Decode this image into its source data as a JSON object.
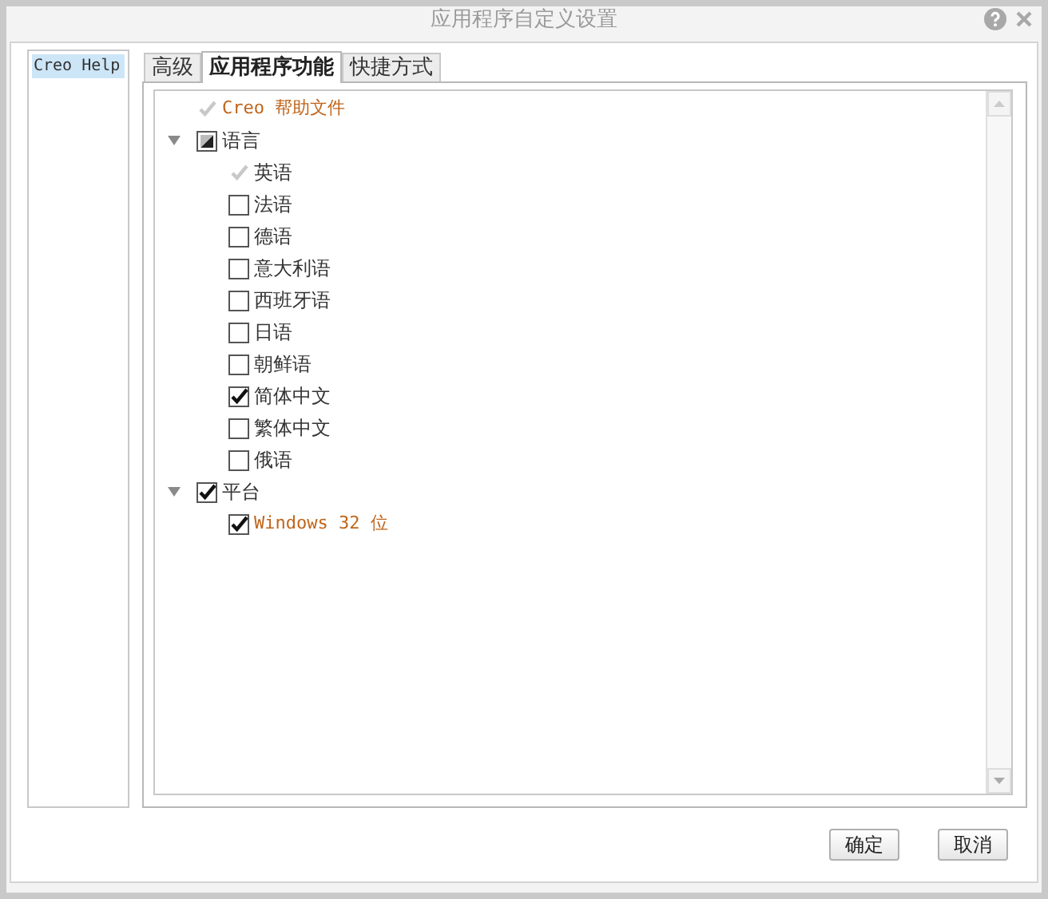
{
  "window": {
    "title": "应用程序自定义设置"
  },
  "sidebar": {
    "items": [
      {
        "label": "Creo Help",
        "selected": true
      }
    ]
  },
  "tabs": [
    {
      "label": "高级",
      "selected": false
    },
    {
      "label": "应用程序功能",
      "selected": true
    },
    {
      "label": "快捷方式",
      "selected": false
    }
  ],
  "tree": [
    {
      "label": "Creo 帮助文件",
      "checked": true,
      "indeterminate": false,
      "disabled": true,
      "kind": "code"
    },
    {
      "label": "语言",
      "checked": false,
      "indeterminate": true,
      "disabled": false,
      "expanded": true,
      "children": [
        {
          "label": "英语",
          "checked": true,
          "indeterminate": false,
          "disabled": true
        },
        {
          "label": "法语",
          "checked": false,
          "indeterminate": false,
          "disabled": false
        },
        {
          "label": "德语",
          "checked": false,
          "indeterminate": false,
          "disabled": false
        },
        {
          "label": "意大利语",
          "checked": false,
          "indeterminate": false,
          "disabled": false
        },
        {
          "label": "西班牙语",
          "checked": false,
          "indeterminate": false,
          "disabled": false
        },
        {
          "label": "日语",
          "checked": false,
          "indeterminate": false,
          "disabled": false
        },
        {
          "label": "朝鲜语",
          "checked": false,
          "indeterminate": false,
          "disabled": false
        },
        {
          "label": "简体中文",
          "checked": true,
          "indeterminate": false,
          "disabled": false
        },
        {
          "label": "繁体中文",
          "checked": false,
          "indeterminate": false,
          "disabled": false
        },
        {
          "label": "俄语",
          "checked": false,
          "indeterminate": false,
          "disabled": false
        }
      ]
    },
    {
      "label": "平台",
      "checked": true,
      "indeterminate": false,
      "disabled": false,
      "expanded": true,
      "children": [
        {
          "label": "Windows 32 位",
          "checked": true,
          "indeterminate": false,
          "disabled": false,
          "kind": "code"
        }
      ]
    }
  ],
  "buttons": [
    "确定",
    "取消"
  ]
}
